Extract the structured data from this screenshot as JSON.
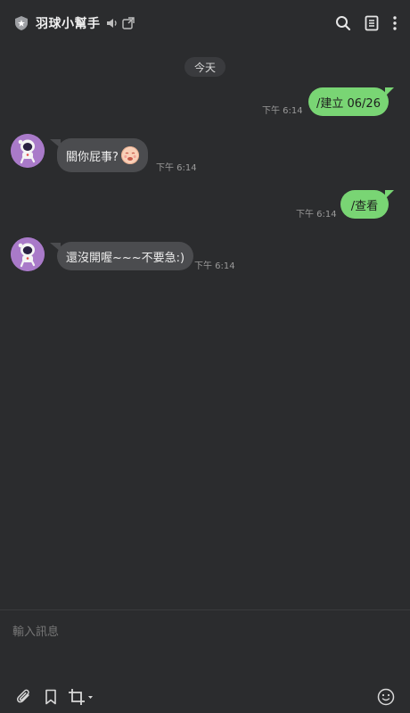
{
  "header": {
    "title": "羽球小幫手",
    "icons": [
      "shield-icon",
      "speaker-icon",
      "external-link-icon",
      "search-icon",
      "notes-icon",
      "more-vertical-icon"
    ]
  },
  "date_separator": "今天",
  "messages": [
    {
      "direction": "out",
      "text": "/建立 06/26",
      "time": "下午 6:14"
    },
    {
      "direction": "in",
      "text": "關你屁事?",
      "emoji": "tired-face-emoji",
      "time": "下午 6:14"
    },
    {
      "direction": "out",
      "text": "/查看",
      "time": "下午 6:14"
    },
    {
      "direction": "in",
      "text": "還沒開喔~~~不要急:)",
      "time": "下午 6:14"
    }
  ],
  "composer": {
    "placeholder": "輸入訊息",
    "tools": [
      "paperclip-icon",
      "bookmark-icon",
      "crop-icon",
      "emoji-icon"
    ]
  },
  "colors": {
    "background": "#2b2c2e",
    "outgoing_bubble": "#79d574",
    "incoming_bubble": "#4b4c4f",
    "avatar_bg": "#a97ac9"
  }
}
